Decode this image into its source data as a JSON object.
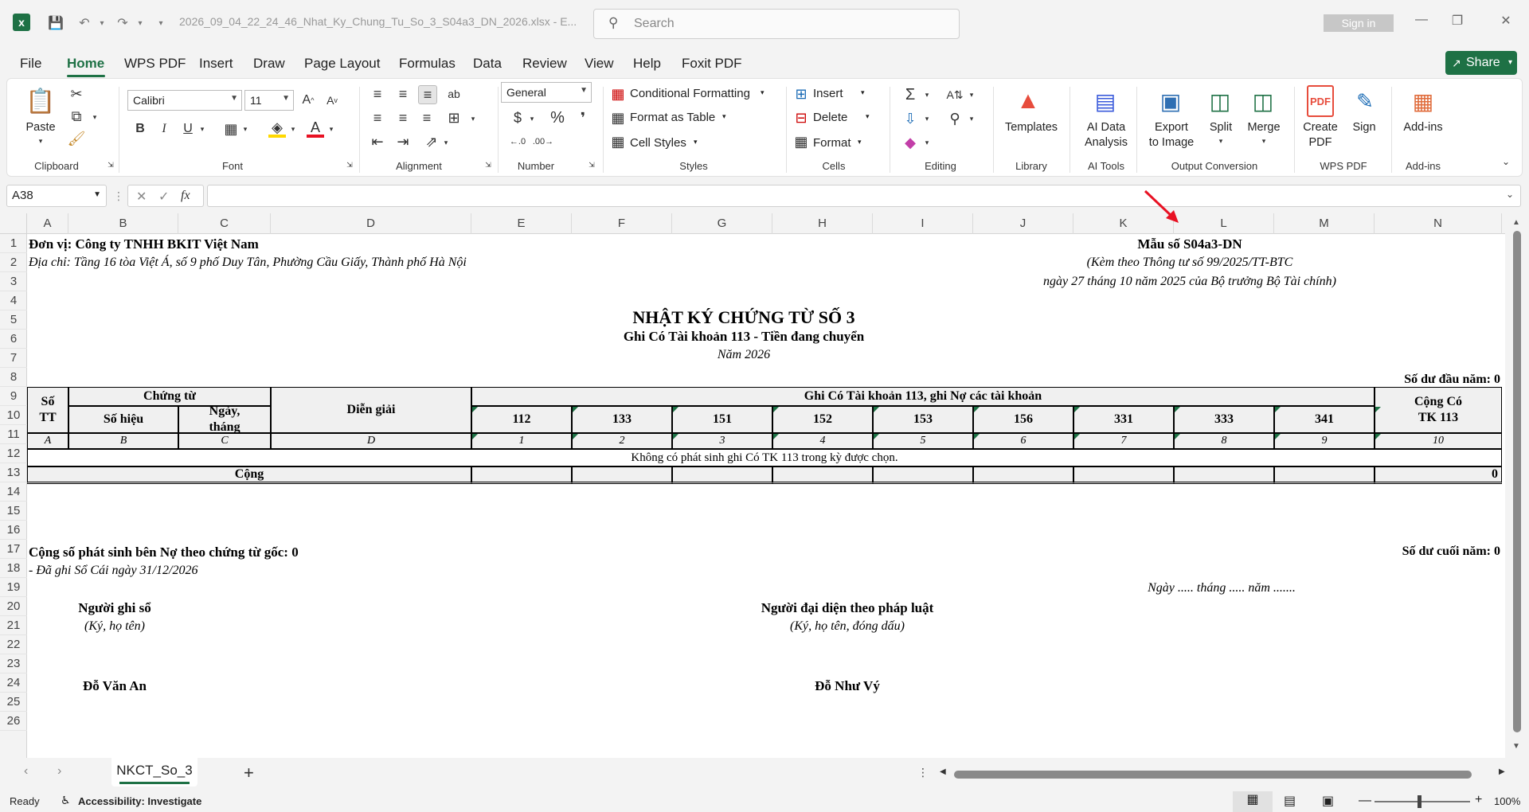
{
  "titlebar": {
    "file_title": "2026_09_04_22_24_46_Nhat_Ky_Chung_Tu_So_3_S04a3_DN_2026.xlsx - E...",
    "search_placeholder": "Search",
    "sign_in": "Sign in",
    "app_icon": "excel-icon",
    "accent_color": "#1e7145"
  },
  "menu": {
    "tabs": [
      "File",
      "Home",
      "WPS PDF",
      "Insert",
      "Draw",
      "Page Layout",
      "Formulas",
      "Data",
      "Review",
      "View",
      "Help",
      "Foxit PDF"
    ],
    "active_tab": "Home",
    "share_label": "Share"
  },
  "ribbon": {
    "clipboard": {
      "label": "Clipboard",
      "paste": "Paste"
    },
    "font": {
      "label": "Font",
      "font_name": "Calibri",
      "font_size": "11",
      "bold": "B",
      "italic": "I",
      "underline": "U"
    },
    "alignment": {
      "label": "Alignment"
    },
    "number": {
      "label": "Number",
      "format": "General"
    },
    "styles": {
      "label": "Styles",
      "conditional": "Conditional Formatting",
      "format_table": "Format as Table",
      "cell_styles": "Cell Styles"
    },
    "cells": {
      "label": "Cells",
      "insert": "Insert",
      "delete": "Delete",
      "format": "Format"
    },
    "editing": {
      "label": "Editing"
    },
    "library": {
      "label": "Library",
      "templates": "Templates"
    },
    "ai_tools": {
      "label": "AI Tools",
      "ai_line1": "AI Data",
      "ai_line2": "Analysis"
    },
    "output": {
      "label": "Output Conversion",
      "export1": "Export",
      "export2": "to Image",
      "split": "Split",
      "merge": "Merge"
    },
    "wps_pdf": {
      "label": "WPS PDF",
      "create1": "Create",
      "create2": "PDF",
      "sign": "Sign"
    },
    "addins": {
      "label": "Add-ins",
      "addins_btn": "Add-ins"
    }
  },
  "formula_bar": {
    "name_box": "A38",
    "fx": "fx",
    "value": ""
  },
  "columns": [
    "A",
    "B",
    "C",
    "D",
    "E",
    "F",
    "G",
    "H",
    "I",
    "J",
    "K",
    "L",
    "M",
    "N"
  ],
  "rows": [
    "1",
    "2",
    "3",
    "4",
    "5",
    "6",
    "7",
    "8",
    "9",
    "10",
    "11",
    "12",
    "13",
    "14",
    "15",
    "16",
    "17",
    "18",
    "19",
    "20",
    "21",
    "22",
    "23",
    "24",
    "25",
    "26"
  ],
  "sheet": {
    "unit": "Đơn vị: Công ty TNHH BKIT Việt Nam",
    "address": "Địa chỉ: Tầng 16 tòa Việt Á, số 9 phố Duy Tân, Phường Cầu Giấy, Thành phố Hà Nội",
    "form_code": "Mẫu số S04a3-DN",
    "form_note1": "(Kèm theo Thông tư số 99/2025/TT-BTC",
    "form_note2": "ngày 27 tháng 10 năm 2025 của Bộ trưởng Bộ Tài chính)",
    "title": "NHẬT KÝ CHỨNG TỪ SỐ 3",
    "subtitle": "Ghi Có Tài khoản 113 - Tiền đang chuyển",
    "year": "Năm 2026",
    "opening_balance": "Số dư đầu năm: 0",
    "table": {
      "h_stt": "Số TT",
      "h_chungtu": "Chứng từ",
      "h_sohieu": "Số hiệu",
      "h_ngay": "Ngày, tháng",
      "h_diengiai": "Diễn giải",
      "h_ghico": "Ghi Có Tài khoản 113, ghi Nợ các tài khoản",
      "h_cong": "Cộng Có TK 113",
      "accounts": [
        "112",
        "133",
        "151",
        "152",
        "153",
        "156",
        "331",
        "333",
        "341"
      ],
      "code_row": [
        "A",
        "B",
        "C",
        "D",
        "1",
        "2",
        "3",
        "4",
        "5",
        "6",
        "7",
        "8",
        "9",
        "10"
      ],
      "empty_msg": "Không có phát sinh ghi Có TK 113 trong kỳ được chọn.",
      "total_label": "Cộng",
      "total_value": "0"
    },
    "debit_total": "Cộng số phát sinh bên Nợ theo chứng từ gốc: 0",
    "closing_balance": "Số dư cuối năm: 0",
    "recorded": "- Đã ghi Sổ Cái ngày 31/12/2026",
    "date_line": "Ngày ..... tháng ..... năm .......",
    "signer1_title": "Người ghi sổ",
    "signer1_note": "(Ký, họ tên)",
    "signer2_title": "Người đại diện theo pháp luật",
    "signer2_note": "(Ký, họ tên, đóng dấu)",
    "signer1_name": "Đỗ Văn An",
    "signer2_name": "Đỗ Như Vý"
  },
  "sheet_tabs": {
    "active": "NKCT_So_3",
    "add": "+"
  },
  "status": {
    "ready": "Ready",
    "accessibility": "Accessibility: Investigate",
    "zoom": "100%"
  }
}
